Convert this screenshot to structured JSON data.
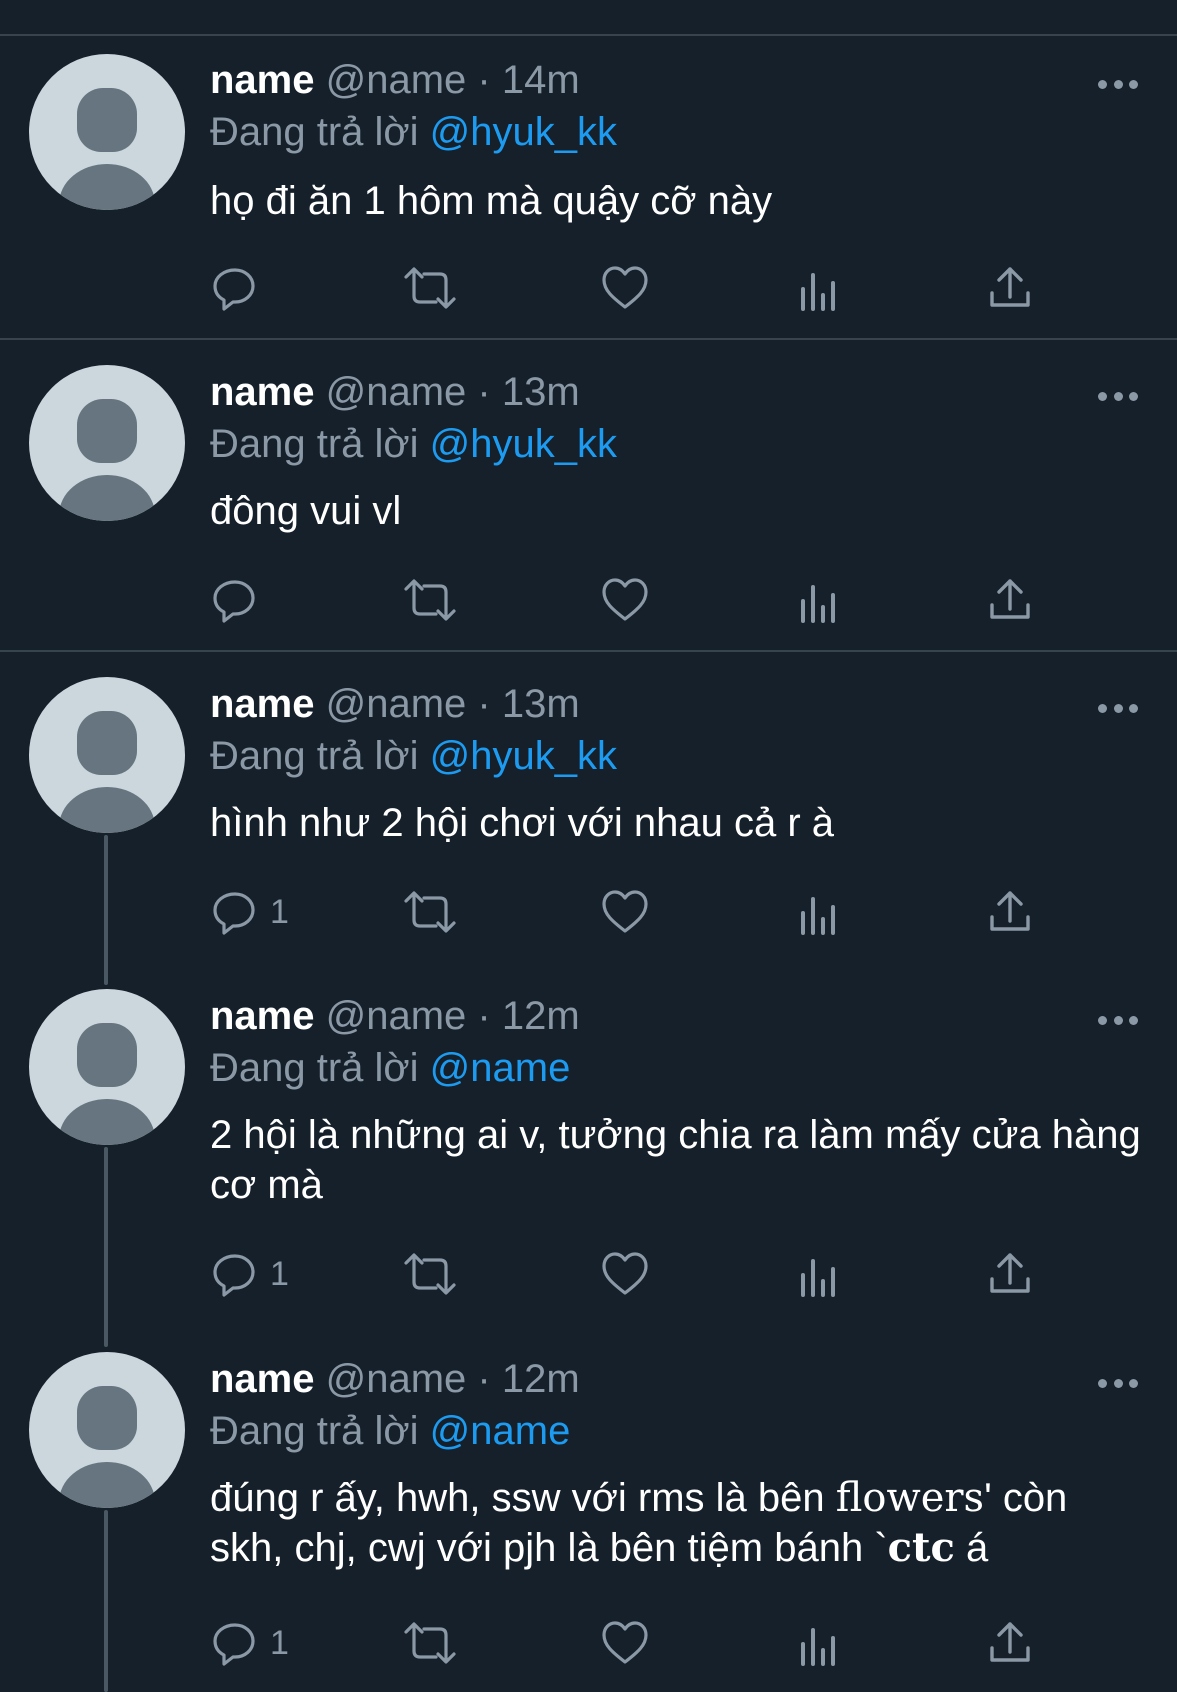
{
  "tweets": [
    {
      "name": "name",
      "handle": "@name",
      "time": "14m",
      "reply_prefix": "Đang trả lời",
      "reply_to": "@hyuk_kk",
      "text": "họ đi ăn 1 hôm mà quậy cỡ này",
      "reply_count": ""
    },
    {
      "name": "name",
      "handle": "@name",
      "time": "13m",
      "reply_prefix": "Đang trả lời",
      "reply_to": "@hyuk_kk",
      "text": "đông vui vl",
      "reply_count": ""
    },
    {
      "name": "name",
      "handle": "@name",
      "time": "13m",
      "reply_prefix": "Đang trả lời",
      "reply_to": "@hyuk_kk",
      "text": "hình như 2 hội chơi với nhau cả r à",
      "reply_count": "1"
    },
    {
      "name": "name",
      "handle": "@name",
      "time": "12m",
      "reply_prefix": "Đang trả lời",
      "reply_to": "@name",
      "text": "2 hội là những ai v, tưởng chia ra làm mấy cửa hàng cơ mà",
      "reply_count": "1"
    },
    {
      "name": "name",
      "handle": "@name",
      "time": "12m",
      "reply_prefix": "Đang trả lời",
      "reply_to": "@name",
      "text_a": "đúng r ấy, hwh, ssw với rms là bên ",
      "text_fancy1": "flowers",
      "text_b": "' còn skh, chj, cwj với pjh là bên tiệm bánh `",
      "text_fancy2": "ctc",
      "text_c": " á",
      "reply_count": "1"
    }
  ],
  "separator": "·",
  "icons": {
    "reply": "reply-icon",
    "retweet": "retweet-icon",
    "like": "like-icon",
    "views": "views-icon",
    "share": "share-icon",
    "more": "more-icon"
  },
  "colors": {
    "background": "#15202b",
    "accent": "#1d9bf0",
    "muted": "#8b98a5",
    "divider": "#38444d"
  }
}
